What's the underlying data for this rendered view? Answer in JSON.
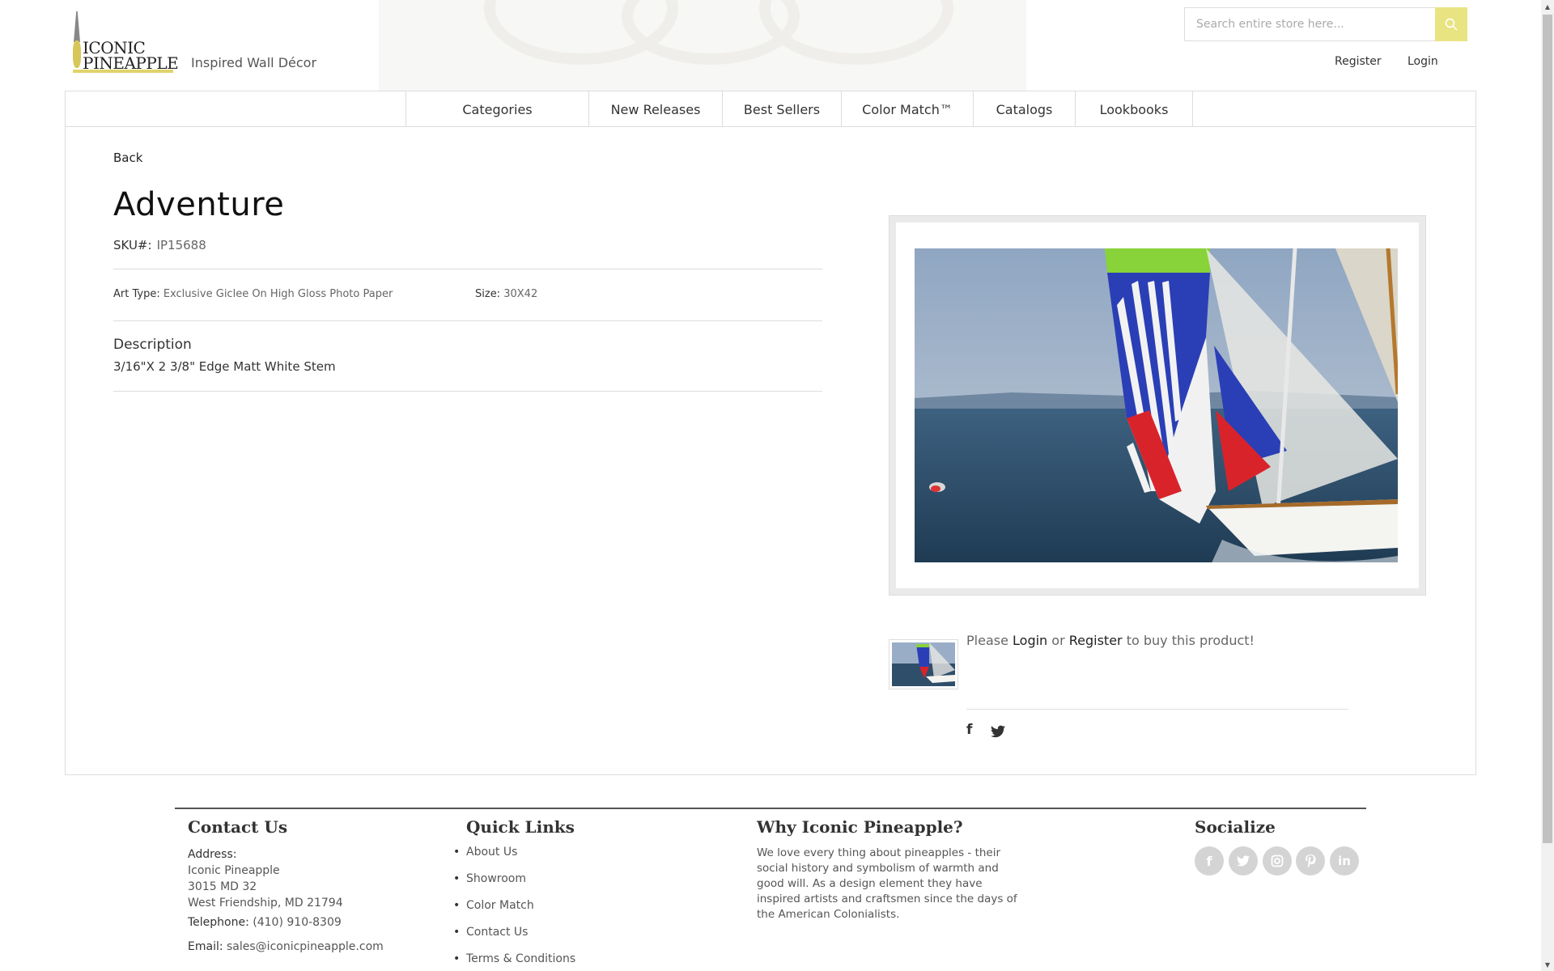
{
  "header": {
    "logo_line1": "ICONIC",
    "logo_line2": "PINEAPPLE",
    "tagline": "Inspired Wall Décor",
    "search_placeholder": "Search entire store here...",
    "register_label": "Register",
    "login_label": "Login"
  },
  "nav": {
    "items": [
      {
        "label": "Categories"
      },
      {
        "label": "New Releases"
      },
      {
        "label": "Best Sellers"
      },
      {
        "label": "Color Match™"
      },
      {
        "label": "Catalogs"
      },
      {
        "label": "Lookbooks"
      }
    ]
  },
  "product": {
    "back_label": "Back",
    "title": "Adventure",
    "sku_label": "SKU#:",
    "sku_value": "IP15688",
    "art_type_label": "Art Type:",
    "art_type_value": "Exclusive Giclee On High Gloss Photo Paper",
    "size_label": "Size:",
    "size_value": "30X42",
    "description_heading": "Description",
    "description_text": "3/16\"X 2 3/8\" Edge Matt White Stem",
    "buy_prefix": "Please",
    "buy_login": "Login",
    "buy_or": "or",
    "buy_register": "Register",
    "buy_suffix": "to buy this product!"
  },
  "footer": {
    "contact": {
      "heading": "Contact Us",
      "address_label": "Address:",
      "address_line1": "Iconic Pineapple",
      "address_line2": "3015 MD 32",
      "address_line3": "West Friendship, MD 21794",
      "telephone_label": "Telephone:",
      "telephone_value": "(410) 910-8309",
      "email_label": "Email:",
      "email_value": "sales@iconicpineapple.com"
    },
    "quick_links": {
      "heading": "Quick Links",
      "items": [
        {
          "label": "About Us"
        },
        {
          "label": "Showroom"
        },
        {
          "label": "Color Match"
        },
        {
          "label": "Contact Us"
        },
        {
          "label": "Terms & Conditions"
        }
      ]
    },
    "why": {
      "heading": "Why Iconic Pineapple?",
      "text": "We love every thing about pineapples - their social history and symbolism of warmth and good will. As a design element they have inspired artists and craftsmen since the days of the American Colonialists."
    },
    "socialize": {
      "heading": "Socialize",
      "icons": [
        "facebook-icon",
        "twitter-icon",
        "instagram-icon",
        "pinterest-icon",
        "linkedin-icon"
      ]
    }
  },
  "colors": {
    "accent": "#e9e482",
    "logo_bar": "#e0d36b",
    "border": "#dddddd"
  }
}
